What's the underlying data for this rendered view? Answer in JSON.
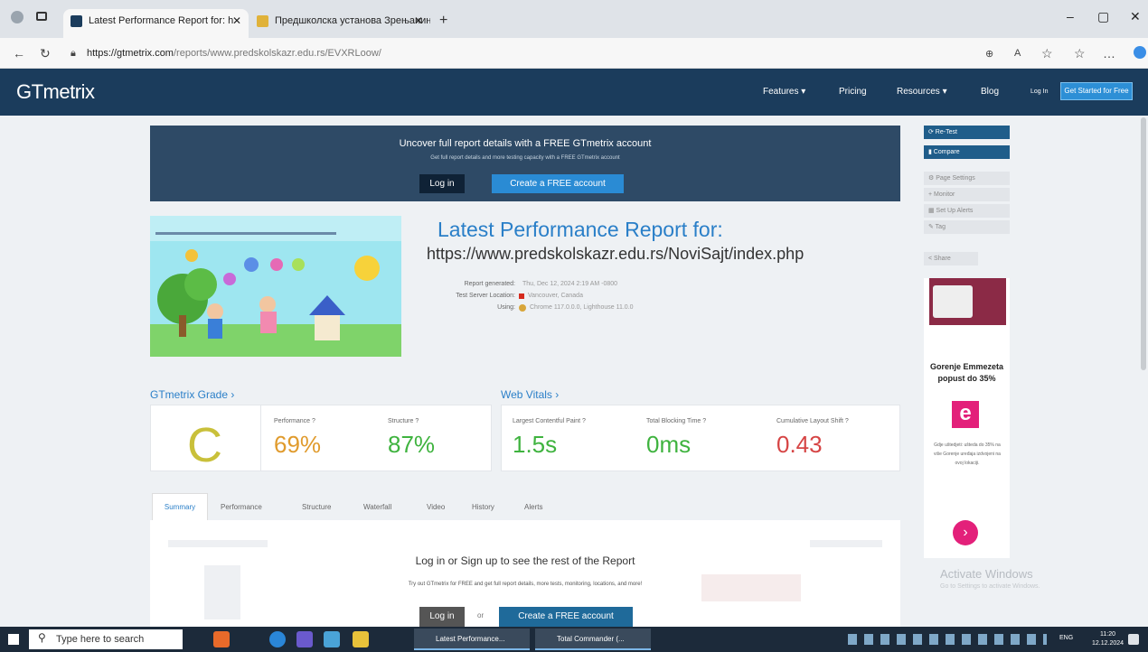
{
  "browser": {
    "tabs": [
      {
        "label": "Latest Performance Report for: h",
        "active": true
      },
      {
        "label": "Предшколска установа Зрењанин",
        "active": false
      }
    ],
    "url_domain": "https://gtmetrix.com",
    "url_path": "/reports/www.predskolskazr.edu.rs/EVXRLoow/"
  },
  "site": {
    "logo": "GTmetrix",
    "nav": [
      "Features ▾",
      "Pricing",
      "Resources ▾",
      "Blog",
      "Log In"
    ],
    "cta": "Get Started for Free"
  },
  "banner": {
    "title": "Uncover full report details with a FREE GTmetrix account",
    "subtitle": "Get full report details and more testing capacity with a FREE GTmetrix account",
    "login": "Log in",
    "create": "Create a FREE account"
  },
  "report": {
    "title": "Latest Performance Report for:",
    "url": "https://www.predskolskazr.edu.rs/NoviSajt/index.php",
    "meta": [
      {
        "label": "Report generated:",
        "value": "Thu, Dec 12, 2024 2:19 AM -0800"
      },
      {
        "label": "Test Server Location:",
        "value": "Vancouver, Canada"
      },
      {
        "label": "Using:",
        "value": "Chrome 117.0.0.0, Lighthouse 11.0.0"
      }
    ]
  },
  "grade": {
    "heading": "GTmetrix Grade ›",
    "letter": "C",
    "performance_label": "Performance ?",
    "performance": "69%",
    "structure_label": "Structure ?",
    "structure": "87%"
  },
  "vitals": {
    "heading": "Web Vitals ›",
    "lcp_label": "Largest Contentful Paint ?",
    "lcp": "1.5s",
    "tbt_label": "Total Blocking Time ?",
    "tbt": "0ms",
    "cls_label": "Cumulative Layout Shift ?",
    "cls": "0.43"
  },
  "colors": {
    "grade_c": "#c9c03a",
    "orange": "#e09b2d",
    "green": "#3fb33f",
    "blue": "#2a7fc8",
    "red": "#d64545"
  },
  "report_tabs": [
    "Summary",
    "Performance",
    "Structure",
    "Waterfall",
    "Video",
    "History",
    "Alerts"
  ],
  "locked": {
    "title": "Log in or Sign up to see the rest of the Report",
    "subtitle": "Try out GTmetrix for FREE and get full report details, more tests, monitoring, locations, and more!",
    "login": "Log in",
    "or": "or",
    "create": "Create a FREE account"
  },
  "sidebar": {
    "buttons": [
      "⟳ Re-Test",
      "▮ Compare"
    ],
    "light_buttons": [
      "⚙ Page Settings",
      "+ Monitor",
      "▦ Set Up Alerts",
      "✎ Tag"
    ],
    "share": "< Share",
    "ad_title": "Gorenje Emmezeta popust do 35%",
    "ad_logo": "e",
    "ad_text": "Gdje uštedjeti: ušteda do 35% na više Gorenje uređaja izdvojeni na ovoj lokaciji.",
    "ad_arrow": "›"
  },
  "watermark": {
    "line1": "Activate Windows",
    "line2": "Go to Settings to activate Windows."
  },
  "taskbar": {
    "search": "Type here to search",
    "apps": [
      "Latest Performance...",
      "Total Commander (..."
    ],
    "lang": "ENG",
    "time": "11:20",
    "date": "12.12.2024"
  }
}
